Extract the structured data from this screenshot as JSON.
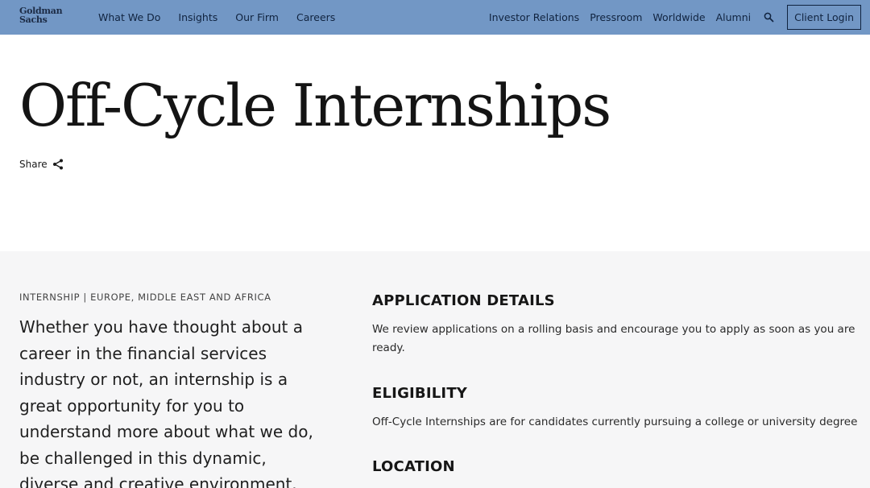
{
  "header": {
    "logo_line1": "Goldman",
    "logo_line2": "Sachs",
    "nav_left": [
      "What We Do",
      "Insights",
      "Our Firm",
      "Careers"
    ],
    "nav_right": [
      "Investor Relations",
      "Pressroom",
      "Worldwide",
      "Alumni"
    ],
    "search_icon": "search-icon",
    "client_login": "Client Login",
    "bg_color": "#7297c5"
  },
  "hero": {
    "title": "Off-Cycle Internships",
    "share_label": "Share"
  },
  "details": {
    "eyebrow": "INTERNSHIP | EUROPE, MIDDLE EAST AND AFRICA",
    "lead": "Whether you have thought about a career in the financial services industry or not, an internship is a great opportunity for you to understand more about what we do, be challenged in this dynamic, diverse and creative environment.",
    "sections": [
      {
        "heading": "APPLICATION DETAILS",
        "body": "We review applications on a rolling basis and encourage you to apply as soon as you are ready."
      },
      {
        "heading": "ELIGIBILITY",
        "body": "Off-Cycle Internships are for candidates currently pursuing a college or university degree"
      },
      {
        "heading": "LOCATION",
        "body": ""
      }
    ]
  }
}
